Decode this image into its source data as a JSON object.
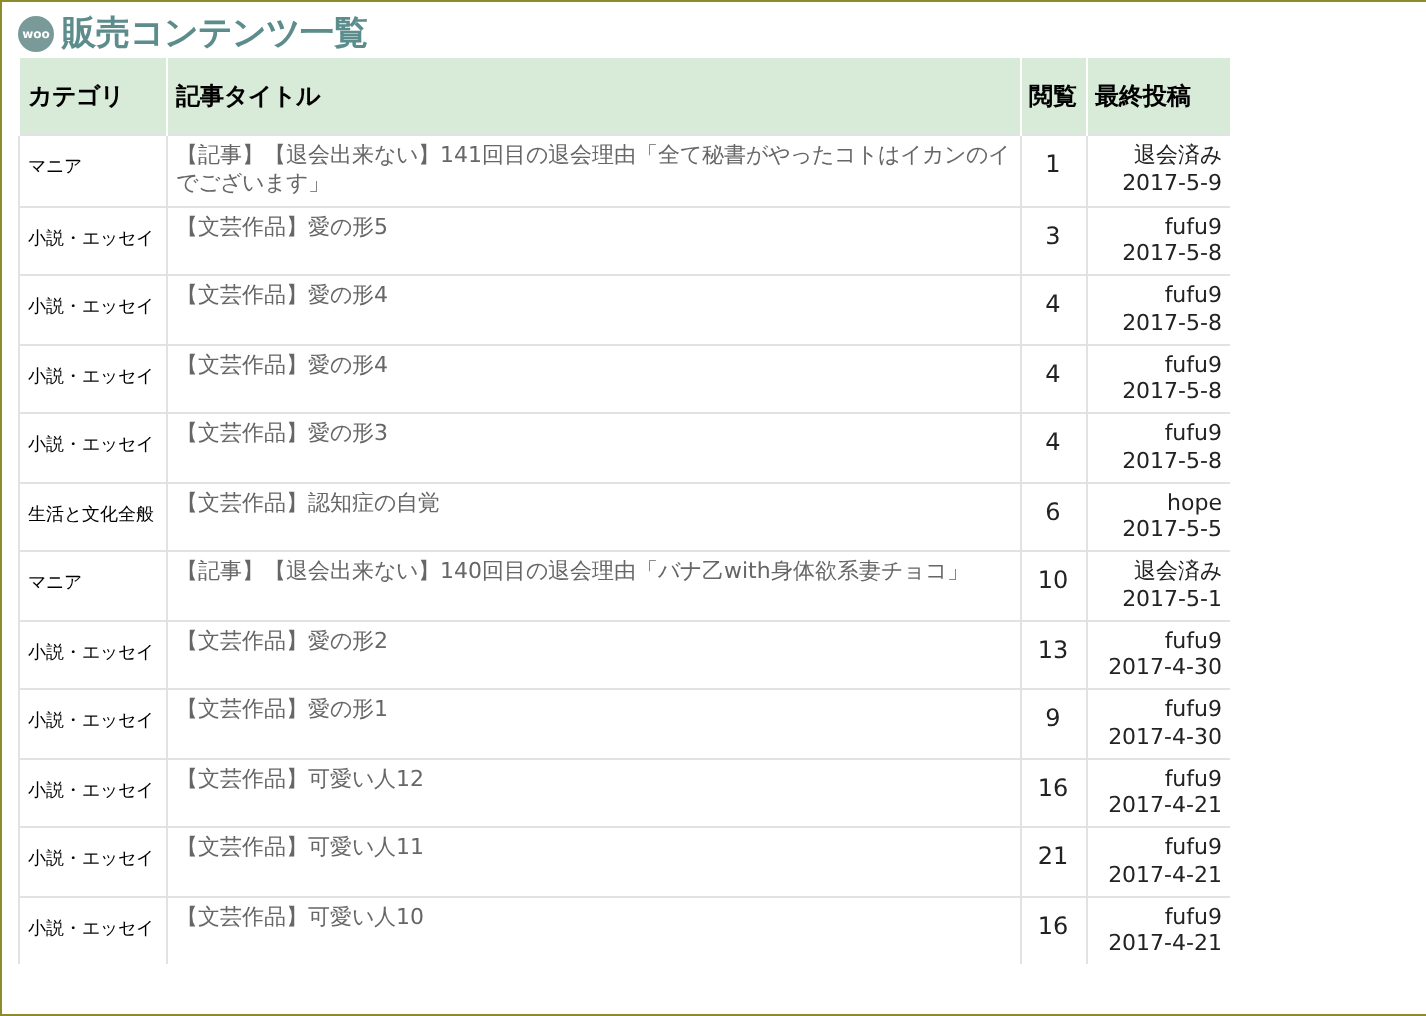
{
  "heading": {
    "logo_text": "woo",
    "title": "販売コンテンツ一覧"
  },
  "table": {
    "columns": [
      "カテゴリ",
      "記事タイトル",
      "閲覧",
      "最終投稿"
    ],
    "rows": [
      {
        "category": "マニア",
        "title": "【記事】【退会出来ない】141回目の退会理由「全て秘書がやったコトはイカンのイでございます」",
        "views": "1",
        "poster": "退会済み",
        "date": "2017-5-9"
      },
      {
        "category": "小説・エッセイ",
        "title": "【文芸作品】愛の形5",
        "views": "3",
        "poster": "fufu9",
        "date": "2017-5-8"
      },
      {
        "category": "小説・エッセイ",
        "title": "【文芸作品】愛の形4",
        "views": "4",
        "poster": "fufu9",
        "date": "2017-5-8"
      },
      {
        "category": "小説・エッセイ",
        "title": "【文芸作品】愛の形4",
        "views": "4",
        "poster": "fufu9",
        "date": "2017-5-8"
      },
      {
        "category": "小説・エッセイ",
        "title": "【文芸作品】愛の形3",
        "views": "4",
        "poster": "fufu9",
        "date": "2017-5-8"
      },
      {
        "category": "生活と文化全般",
        "title": "【文芸作品】認知症の自覚",
        "views": "6",
        "poster": "hope",
        "date": "2017-5-5"
      },
      {
        "category": "マニア",
        "title": "【記事】【退会出来ない】140回目の退会理由「バナ乙with身体欲系妻チョコ」",
        "views": "10",
        "poster": "退会済み",
        "date": "2017-5-1"
      },
      {
        "category": "小説・エッセイ",
        "title": "【文芸作品】愛の形2",
        "views": "13",
        "poster": "fufu9",
        "date": "2017-4-30"
      },
      {
        "category": "小説・エッセイ",
        "title": "【文芸作品】愛の形1",
        "views": "9",
        "poster": "fufu9",
        "date": "2017-4-30"
      },
      {
        "category": "小説・エッセイ",
        "title": "【文芸作品】可愛い人12",
        "views": "16",
        "poster": "fufu9",
        "date": "2017-4-21"
      },
      {
        "category": "小説・エッセイ",
        "title": "【文芸作品】可愛い人11",
        "views": "21",
        "poster": "fufu9",
        "date": "2017-4-21"
      },
      {
        "category": "小説・エッセイ",
        "title": "【文芸作品】可愛い人10",
        "views": "16",
        "poster": "fufu9",
        "date": "2017-4-21"
      }
    ]
  }
}
